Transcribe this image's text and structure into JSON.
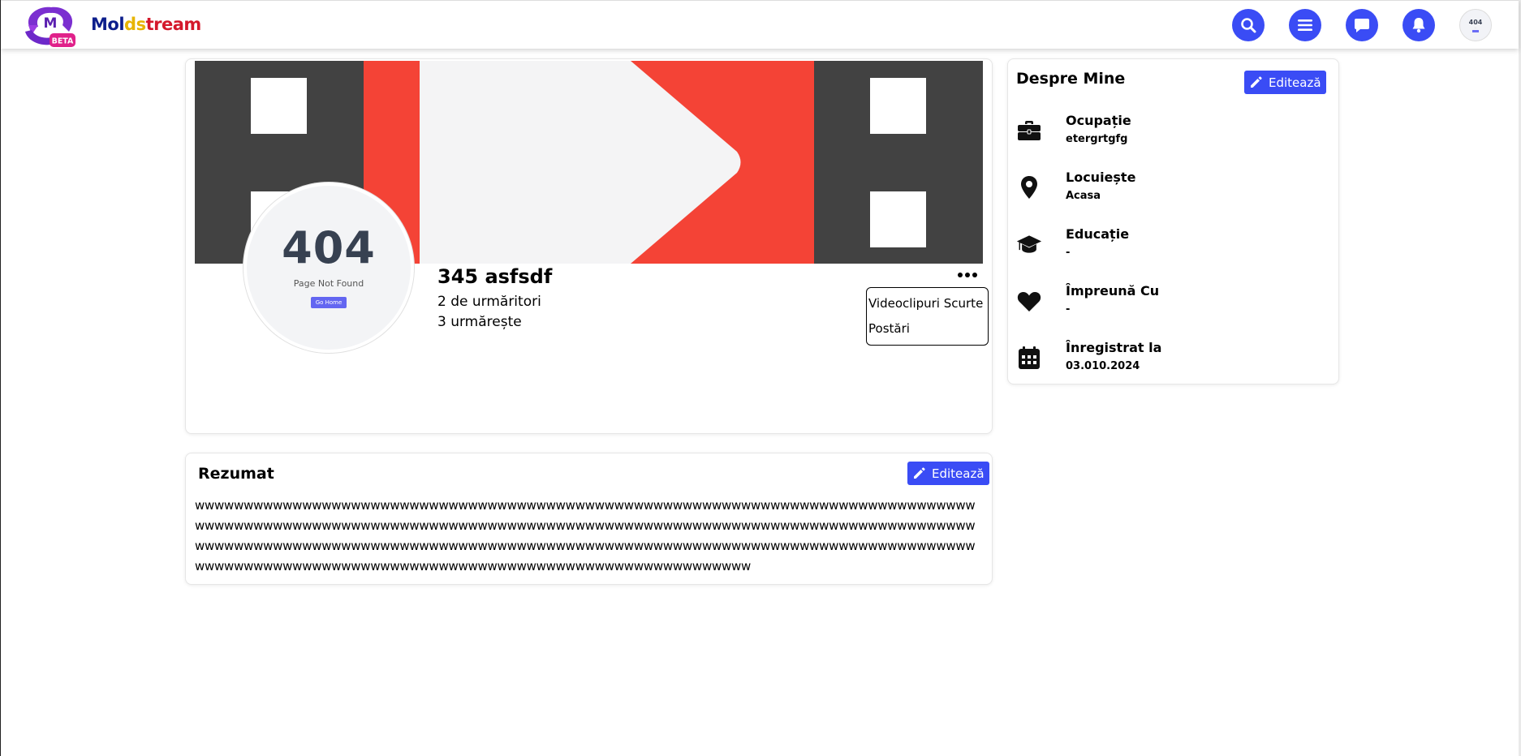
{
  "header": {
    "logo_letter": "M",
    "logo_badge": "BETA",
    "brand_parts": [
      "Mol",
      "ds",
      "tr",
      "eam"
    ],
    "icons": [
      "search-icon",
      "menu-icon",
      "chat-icon",
      "bell-icon"
    ],
    "avatar_text": "404"
  },
  "profile": {
    "avatar_code": "404",
    "avatar_message": "Page Not Found",
    "avatar_button": "Go Home",
    "name": "345 asfsdf",
    "followers": "2 de urmăritori",
    "following": "3 urmărește",
    "menu": [
      "Videoclipuri Scurte",
      "Postări"
    ]
  },
  "about": {
    "title": "Despre Mine",
    "edit_label": "Editează",
    "items": [
      {
        "icon": "briefcase-icon",
        "label": "Ocupație",
        "value": "etergrtgfg"
      },
      {
        "icon": "location-pin-icon",
        "label": "Locuiește",
        "value": "Acasa"
      },
      {
        "icon": "graduation-cap-icon",
        "label": "Educație",
        "value": "-"
      },
      {
        "icon": "heart-icon",
        "label": "Împreună Cu",
        "value": "-"
      },
      {
        "icon": "calendar-icon",
        "label": "Înregistrat la",
        "value": "03.010.2024"
      }
    ]
  },
  "summary": {
    "title": "Rezumat",
    "edit_label": "Editează",
    "text": "wwwwwwwwwwwwwwwwwwwwwwwwwwwwwwwwwwwwwwwwwwwwwwwwwwwwwwwwwwwwwwwwwwwwwwwwwwwwwwwwwwwwwwwwwwwwwwwwwwwwwwwwwwwwwwwwwwwwwwwwwwwwwwwwwwwwwwwwwwwwwwwwwwwwwwwwwwwwwwwwwwwwwwwwwwwwwwwwwwwwwwwwwwwwwwwwwwwwwwwwwwwwwwwwwwwwwwwwwwwwwwwwwwwwwwwwwwwwwwwwwwwwwwwwwwwwwwwwwwwwwwwwwwwwwwwwwwwwwwwwwwwwwwwwwwwwwwwww"
  },
  "colors": {
    "accent": "#3a4cf5",
    "cover_red": "#f44336",
    "cover_dark": "#424242"
  }
}
